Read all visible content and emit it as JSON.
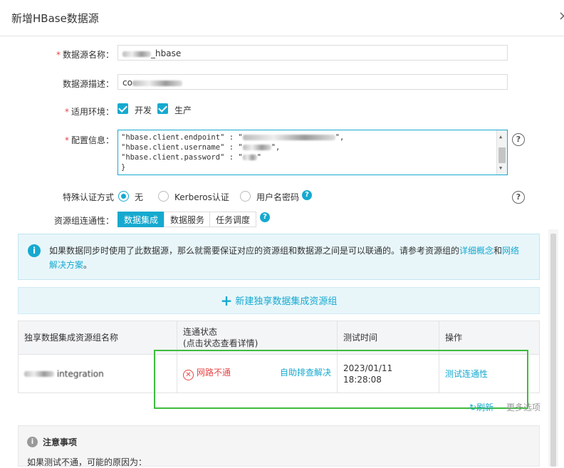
{
  "dialog": {
    "title": "新增HBase数据源",
    "close_icon": "×"
  },
  "form": {
    "name": {
      "label": "数据源名称：",
      "value_suffix": "_hbase"
    },
    "desc": {
      "label": "数据源描述：",
      "value_prefix": "co"
    },
    "env": {
      "label": "适用环境：",
      "options": [
        "开发",
        "生产"
      ]
    },
    "config": {
      "label": "配置信息：",
      "lines": [
        "\"hbase.client.endpoint\" : \"",
        "\"hbase.client.username\" : \"",
        "\"hbase.client.password\" : \"",
        "}"
      ],
      "line_tails": [
        "\",",
        "\",",
        "\""
      ]
    },
    "auth": {
      "label": "特殊认证方式",
      "options": [
        "无",
        "Kerberos认证",
        "用户名密码"
      ],
      "selected": "无"
    },
    "connectivity": {
      "label": "资源组连通性：",
      "tabs": [
        "数据集成",
        "数据服务",
        "任务调度"
      ],
      "active": "数据集成"
    }
  },
  "info": {
    "text": "如果数据同步时使用了此数据源，那么就需要保证对应的资源组和数据源之间是可以联通的。请参考资源组的",
    "link1": "详细概念",
    "and": "和",
    "link2": "网络解决方案",
    "end": "。"
  },
  "add_button": "新建独享数据集成资源组",
  "table": {
    "headers": [
      "独享数据集成资源组名称",
      "连通状态\n(点击状态查看详情)",
      "测试时间",
      "操作"
    ],
    "header_status_line1": "连通状态",
    "header_status_line2": "(点击状态查看详情)",
    "rows": [
      {
        "name_suffix": "integration",
        "status": "网路不通",
        "status_link": "自助排查解决",
        "time_date": "2023/01/11",
        "time_clock": "18:28:08",
        "action": "测试连通性"
      }
    ]
  },
  "refresh": "刷新",
  "more": "更多选项",
  "notice": {
    "title": "注意事项",
    "body": "如果测试不通，可能的原因为："
  },
  "colors": {
    "accent": "#16a9cf",
    "error": "#e54545",
    "highlight_box": "#3dbd3d"
  }
}
